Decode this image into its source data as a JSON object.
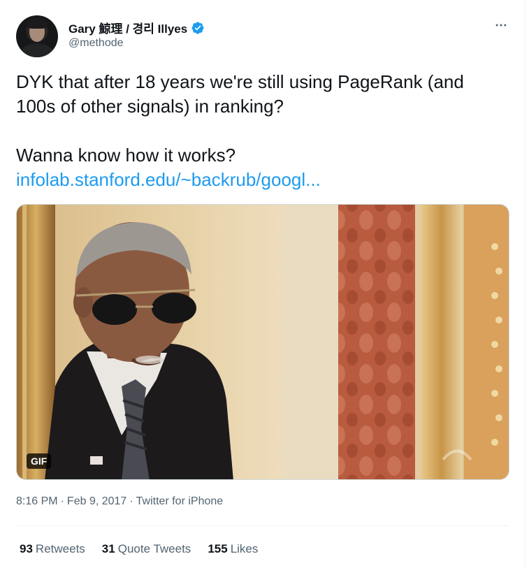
{
  "author": {
    "display_name": "Gary 鯨理 / 경리 Illyes",
    "handle": "@methode",
    "verified": true,
    "verified_icon": "verified-badge-icon",
    "verified_color": "#1d9bf0"
  },
  "menu": {
    "more_icon": "more-horizontal-icon"
  },
  "tweet": {
    "line1": "DYK that after 18 years we're still using PageRank (and",
    "line2": "100s of other signals) in ranking?",
    "line3": "Wanna know how it works?",
    "link_text": "infolab.stanford.edu/~backrub/googl..."
  },
  "media": {
    "badge": "GIF"
  },
  "meta": {
    "time": "8:16 PM",
    "sep1": "·",
    "date": "Feb 9, 2017",
    "sep2": "·",
    "source": "Twitter for iPhone"
  },
  "stats": {
    "retweets_count": "93",
    "retweets_label": "Retweets",
    "quote_count": "31",
    "quote_label": "Quote Tweets",
    "likes_count": "155",
    "likes_label": "Likes"
  },
  "colors": {
    "text": "#0f1419",
    "secondary": "#536471",
    "link": "#1d9bf0"
  }
}
